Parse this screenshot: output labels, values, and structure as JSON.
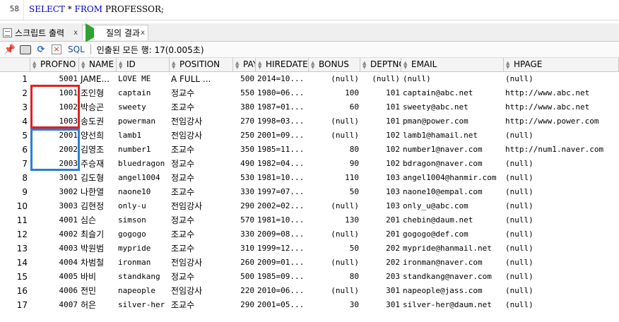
{
  "editor": {
    "line_number": "58",
    "kw_select": "SELECT",
    "star": " * ",
    "kw_from": "FROM",
    "table_name": " PROFESSOR;"
  },
  "tabs": [
    {
      "label": "스크립트 출력",
      "close": "x"
    },
    {
      "label": "질의 결과",
      "close": "x"
    }
  ],
  "toolbar": {
    "sql_label": "SQL",
    "status": "인출된 모든 행: 17(0.005초)"
  },
  "columns": [
    "PROFNO",
    "NAME",
    "ID",
    "POSITION",
    "PAY",
    "HIREDATE",
    "BONUS",
    "DEPTNO",
    "EMAIL",
    "HPAGE"
  ],
  "rows": [
    [
      "1",
      "5001",
      "JAME...",
      "LOVE ME",
      "A FULL ...",
      "500",
      "2014=10...",
      "(null)",
      "(null)",
      "(null)",
      "(null)"
    ],
    [
      "2",
      "1001",
      "조인형",
      "captain",
      "정교수",
      "550",
      "1980=06...",
      "100",
      "101",
      "captain@abc.net",
      "http://www.abc.net"
    ],
    [
      "3",
      "1002",
      "박승곤",
      "sweety",
      "조교수",
      "380",
      "1987=01...",
      "60",
      "101",
      "sweety@abc.net",
      "http://www.abc.net"
    ],
    [
      "4",
      "1003",
      "송도권",
      "powerman",
      "전임강사",
      "270",
      "1998=03...",
      "(null)",
      "101",
      "pman@power.com",
      "http://www.power.com"
    ],
    [
      "5",
      "2001",
      "양선희",
      "lamb1",
      "전임강사",
      "250",
      "2001=09...",
      "(null)",
      "102",
      "lamb1@hamail.net",
      "(null)"
    ],
    [
      "6",
      "2002",
      "김영조",
      "number1",
      "조교수",
      "350",
      "1985=11...",
      "80",
      "102",
      "number1@naver.com",
      "http://num1.naver.com"
    ],
    [
      "7",
      "2003",
      "주승재",
      "bluedragon",
      "정교수",
      "490",
      "1982=04...",
      "90",
      "102",
      "bdragon@naver.com",
      "(null)"
    ],
    [
      "8",
      "3001",
      "김도형",
      "angel1004",
      "정교수",
      "530",
      "1981=10...",
      "110",
      "103",
      "angel1004@hanmir.com",
      "(null)"
    ],
    [
      "9",
      "3002",
      "나한열",
      "naone10",
      "조교수",
      "330",
      "1997=07...",
      "50",
      "103",
      "naone10@empal.com",
      "(null)"
    ],
    [
      "10",
      "3003",
      "김현정",
      "only-u",
      "전임강사",
      "290",
      "2002=02...",
      "(null)",
      "103",
      "only_u@abc.com",
      "(null)"
    ],
    [
      "11",
      "4001",
      "심슨",
      "simson",
      "정교수",
      "570",
      "1981=10...",
      "130",
      "201",
      "chebin@daum.net",
      "(null)"
    ],
    [
      "12",
      "4002",
      "최슬기",
      "gogogo",
      "조교수",
      "330",
      "2009=08...",
      "(null)",
      "201",
      "gogogo@def.com",
      "(null)"
    ],
    [
      "13",
      "4003",
      "박원범",
      "mypride",
      "조교수",
      "310",
      "1999=12...",
      "50",
      "202",
      "mypride@hanmail.net",
      "(null)"
    ],
    [
      "14",
      "4004",
      "차범철",
      "ironman",
      "전임강사",
      "260",
      "2009=01...",
      "(null)",
      "202",
      "ironman@naver.com",
      "(null)"
    ],
    [
      "15",
      "4005",
      "바비",
      "standkang",
      "정교수",
      "500",
      "1985=09...",
      "80",
      "203",
      "standkang@naver.com",
      "(null)"
    ],
    [
      "16",
      "4006",
      "전민",
      "napeople",
      "전임강사",
      "220",
      "2010=06...",
      "(null)",
      "301",
      "napeople@jass.com",
      "(null)"
    ],
    [
      "17",
      "4007",
      "허은",
      "silver-her",
      "조교수",
      "290",
      "2001=05...",
      "30",
      "301",
      "silver-her@daum.net",
      "(null)"
    ]
  ],
  "highlight_colors": {
    "red_box": "#e02020",
    "blue_box": "#2a7fd4"
  }
}
